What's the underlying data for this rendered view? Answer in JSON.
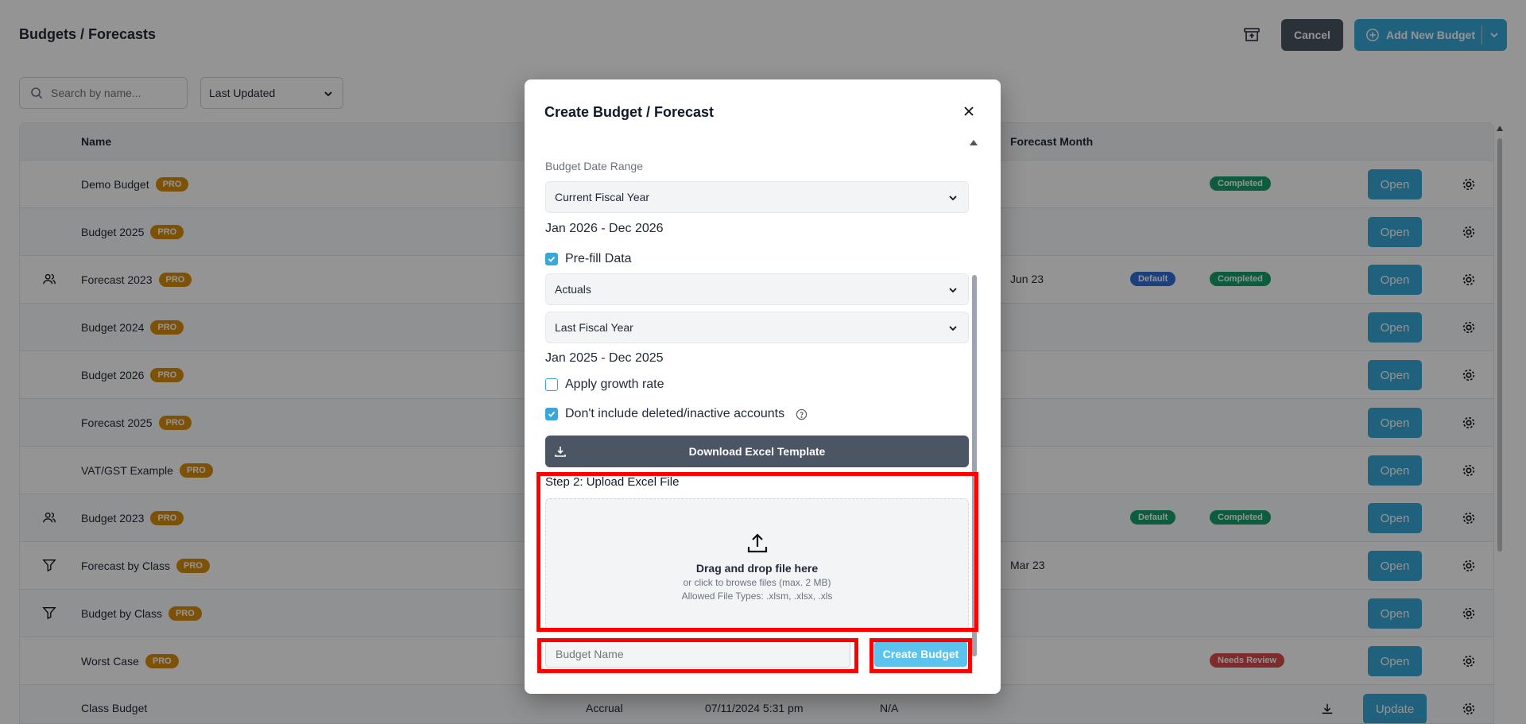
{
  "page": {
    "title": "Budgets / Forecasts",
    "cancel_label": "Cancel",
    "add_label": "Add New Budget",
    "search_placeholder": "Search by name...",
    "sort_value": "Last Updated"
  },
  "table": {
    "columns": {
      "name": "Name",
      "forecast_month": "Forecast Month"
    },
    "rows": [
      {
        "name": "Demo Budget",
        "pro": "PRO",
        "status": "Completed",
        "action": "Open"
      },
      {
        "name": "Budget 2025",
        "pro": "PRO",
        "action": "Open"
      },
      {
        "name": "Forecast 2023",
        "pro": "PRO",
        "icon": "users-icon",
        "month": "Jun 23",
        "default": "Default",
        "status": "Completed",
        "action": "Open"
      },
      {
        "name": "Budget 2024",
        "pro": "PRO",
        "action": "Open"
      },
      {
        "name": "Budget 2026",
        "pro": "PRO",
        "action": "Open"
      },
      {
        "name": "Forecast 2025",
        "pro": "PRO",
        "action": "Open"
      },
      {
        "name": "VAT/GST Example",
        "pro": "PRO",
        "action": "Open"
      },
      {
        "name": "Budget 2023",
        "pro": "PRO",
        "icon": "users-icon",
        "default": "Default",
        "status": "Completed",
        "action": "Open"
      },
      {
        "name": "Forecast by Class",
        "pro": "PRO",
        "icon": "filter-icon",
        "month": "Mar 23",
        "action": "Open"
      },
      {
        "name": "Budget by Class",
        "pro": "PRO",
        "icon": "filter-icon",
        "action": "Open"
      },
      {
        "name": "Worst Case",
        "pro": "PRO",
        "status": "Needs Review",
        "action": "Open"
      },
      {
        "name": "Class Budget",
        "method": "Accrual",
        "updated": "07/11/2024 5:31 pm",
        "month": "N/A",
        "action": "Update"
      }
    ]
  },
  "modal": {
    "title": "Create Budget / Forecast",
    "date_range_label": "Budget Date Range",
    "date_range_value": "Current Fiscal Year",
    "date_range_text": "Jan 2026 - Dec 2026",
    "prefill_label": "Pre-fill Data",
    "prefill_source": "Actuals",
    "prefill_period": "Last Fiscal Year",
    "prefill_text": "Jan 2025 - Dec 2025",
    "growth_label": "Apply growth rate",
    "exclude_label": "Don't include deleted/inactive accounts",
    "download_label": "Download Excel Template",
    "step2_label": "Step 2: Upload Excel File",
    "dropzone_main": "Drag and drop file here",
    "dropzone_sub1": "or click to browse files (max. 2 MB)",
    "dropzone_sub2": "Allowed File Types: .xlsm, .xlsx, .xls",
    "name_placeholder": "Budget Name",
    "create_label": "Create Budget"
  },
  "colors": {
    "accent": "#38a7d9",
    "highlight": "#ff0000",
    "pro_badge": "#d98e0b",
    "completed": "#14a06a",
    "default": "#2f6fd8",
    "needs_review": "#d94b4b"
  }
}
